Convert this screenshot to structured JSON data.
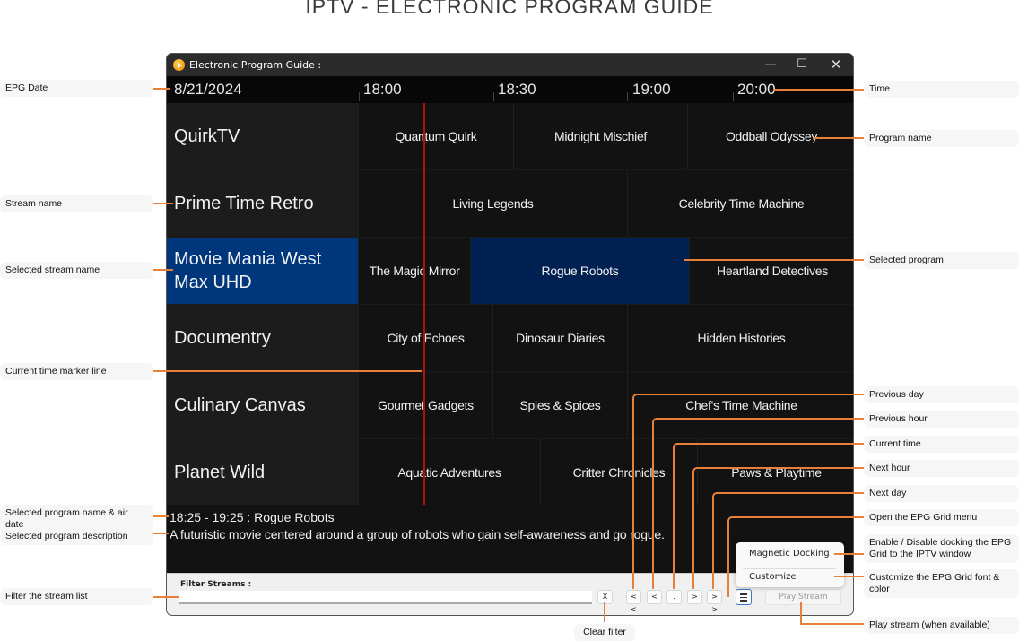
{
  "page_title": "IPTV - ELECTRONIC PROGRAM GUIDE",
  "window": {
    "title": "Electronic Program Guide :",
    "controls": {
      "minimize": "—",
      "maximize": "☐",
      "close": "✕"
    }
  },
  "header": {
    "date": "8/21/2024",
    "times": [
      "18:00",
      "18:30",
      "19:00",
      "20:00"
    ]
  },
  "streams": [
    {
      "name": "QuirkTV",
      "selected": false,
      "programs": [
        {
          "name": "Quantum Quirk",
          "selected": false
        },
        {
          "name": "Midnight Mischief",
          "selected": false
        },
        {
          "name": "Oddball Odyssey",
          "selected": false
        }
      ]
    },
    {
      "name": "Prime Time Retro",
      "selected": false,
      "programs": [
        {
          "name": "Living Legends",
          "selected": false
        },
        {
          "name": "Celebrity Time Machine",
          "selected": false
        }
      ]
    },
    {
      "name": "Movie Mania West Max UHD",
      "selected": true,
      "programs": [
        {
          "name": "The Magic Mirror",
          "selected": false
        },
        {
          "name": "Rogue Robots",
          "selected": true
        },
        {
          "name": "Heartland Detectives",
          "selected": false
        }
      ]
    },
    {
      "name": "Documentry",
      "selected": false,
      "programs": [
        {
          "name": "City of Echoes",
          "selected": false
        },
        {
          "name": "Dinosaur Diaries",
          "selected": false
        },
        {
          "name": "Hidden Histories",
          "selected": false
        }
      ]
    },
    {
      "name": "Culinary Canvas",
      "selected": false,
      "programs": [
        {
          "name": "Gourmet Gadgets",
          "selected": false
        },
        {
          "name": "Spies & Spices",
          "selected": false
        },
        {
          "name": "Chef's Time Machine",
          "selected": false
        }
      ]
    },
    {
      "name": "Planet Wild",
      "selected": false,
      "programs": [
        {
          "name": "Aquatic Adventures",
          "selected": false
        },
        {
          "name": "Critter Chronicles",
          "selected": false
        },
        {
          "name": "Paws & Playtime",
          "selected": false
        }
      ]
    }
  ],
  "selected_program": {
    "title_line": "18:25 - 19:25 : Rogue Robots",
    "description": "A futuristic movie centered around a group of robots who gain self-awareness and go rogue."
  },
  "bottom_bar": {
    "filter_label": "Filter Streams :",
    "filter_value": "",
    "clear_label": "X",
    "prev_day": "< <",
    "prev_hour": "<",
    "current_time": ".",
    "next_hour": ">",
    "next_day": "> >",
    "play_label": "Play Stream"
  },
  "popup_menu": {
    "items": [
      "Magnetic Docking",
      "Customize"
    ]
  },
  "annotations": {
    "left": [
      "EPG Date",
      "Stream name",
      "Selected stream name",
      "Current time marker line",
      "Selected program name & air date",
      "Selected program description",
      "Filter the stream list"
    ],
    "right": [
      "Time",
      "Program name",
      "Selected program",
      "Previous day",
      "Previous hour",
      "Current time",
      "Next hour",
      "Next day",
      "Open the EPG Grid menu",
      "Enable / Disable docking the EPG Grid to the IPTV window",
      "Customize the EPG Grid font & color",
      "Play stream (when available)"
    ],
    "bottom": "Clear filter"
  },
  "colors": {
    "accent_line": "#e8803a",
    "selected_stream": "#00367c",
    "selected_program": "#002152",
    "time_marker": "#b01010"
  }
}
